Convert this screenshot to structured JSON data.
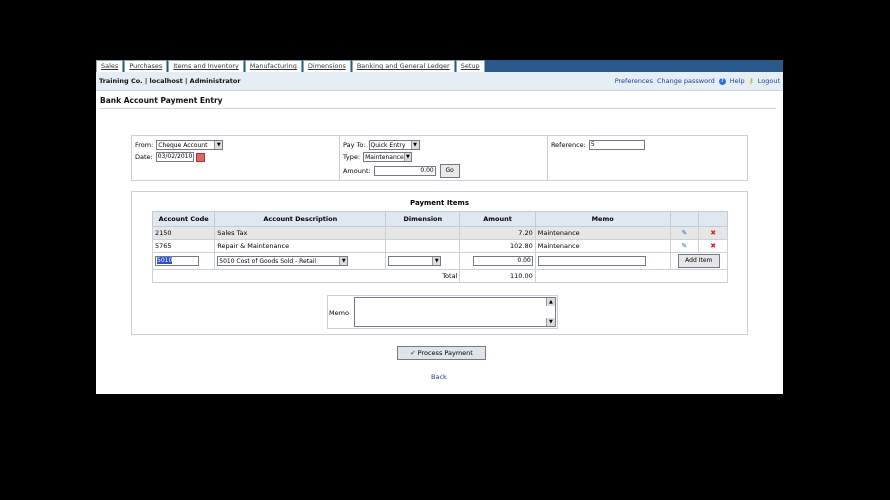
{
  "tabs": [
    "Sales",
    "Purchases",
    "Items and Inventory",
    "Manufacturing",
    "Dimensions",
    "Banking and General Ledger",
    "Setup"
  ],
  "header": {
    "company": "Training Co. | localhost | Administrator",
    "links": {
      "preferences": "Preferences",
      "change_password": "Change password",
      "help": "Help",
      "logout": "Logout"
    }
  },
  "page_title": "Bank Account Payment Entry",
  "form": {
    "from_label": "From:",
    "from_value": "Cheque Account",
    "date_label": "Date:",
    "date_value": "03/02/2010",
    "payto_label": "Pay To:",
    "payto_value": "Quick Entry",
    "type_label": "Type:",
    "type_value": "Maintenance",
    "amount_label": "Amount:",
    "amount_value": "0.00",
    "go_label": "Go",
    "reference_label": "Reference:",
    "reference_value": "5"
  },
  "items": {
    "title": "Payment Items",
    "columns": [
      "Account Code",
      "Account Description",
      "Dimension",
      "Amount",
      "Memo"
    ],
    "rows": [
      {
        "code": "2150",
        "desc": "Sales Tax",
        "dim": "",
        "amount": "7.20",
        "memo": "Maintenance"
      },
      {
        "code": "5765",
        "desc": "Repair & Maintenance",
        "dim": "",
        "amount": "102.80",
        "memo": "Maintenance"
      }
    ],
    "new_row": {
      "code": "5010",
      "desc": "5010   Cost of Goods Sold - Retail",
      "amount": "0.00",
      "add_label": "Add Item"
    },
    "total_label": "Total",
    "total_value": "110.00",
    "memo_label": "Memo"
  },
  "process_label": "Process Payment",
  "back_label": "Back"
}
